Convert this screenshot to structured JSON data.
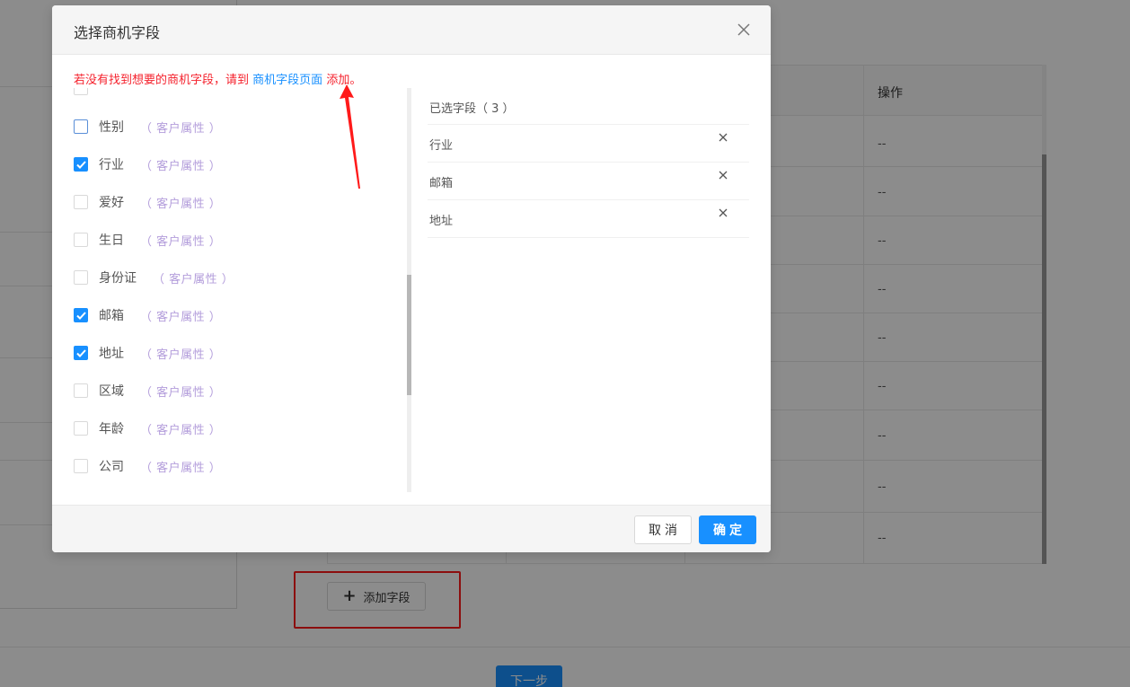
{
  "background": {
    "table": {
      "operation_header": "操作",
      "operation_cells": [
        "--",
        "--",
        "--",
        "--",
        "--",
        "--",
        "--",
        "--",
        "--"
      ]
    },
    "add_field_button": "添加字段",
    "next_step_button": "下一步"
  },
  "modal": {
    "title": "选择商机字段",
    "notice": {
      "prefix": "若没有找到想要的商机字段，请到",
      "link": "商机字段页面",
      "suffix": "添加。"
    },
    "options": [
      {
        "label": "性别",
        "tag": "（ 客户属性 ）",
        "checked": false
      },
      {
        "label": "行业",
        "tag": "（ 客户属性 ）",
        "checked": true
      },
      {
        "label": "爱好",
        "tag": "（ 客户属性 ）",
        "checked": false
      },
      {
        "label": "生日",
        "tag": "（ 客户属性 ）",
        "checked": false
      },
      {
        "label": "身份证",
        "tag": "（ 客户属性 ）",
        "checked": false
      },
      {
        "label": "邮箱",
        "tag": "（ 客户属性 ）",
        "checked": true
      },
      {
        "label": "地址",
        "tag": "（ 客户属性 ）",
        "checked": true
      },
      {
        "label": "区域",
        "tag": "（ 客户属性 ）",
        "checked": false
      },
      {
        "label": "年龄",
        "tag": "（ 客户属性 ）",
        "checked": false
      },
      {
        "label": "公司",
        "tag": "（ 客户属性 ）",
        "checked": false
      }
    ],
    "selected": {
      "title": "已选字段（ 3 ）",
      "items": [
        "行业",
        "邮箱",
        "地址"
      ]
    },
    "cancel_button": "取消",
    "ok_button": "确定"
  },
  "colors": {
    "primary": "#1890ff",
    "notice_red": "#f5222d",
    "tag_purple": "#b39ddb",
    "annotation_red": "#ff1a1a"
  }
}
